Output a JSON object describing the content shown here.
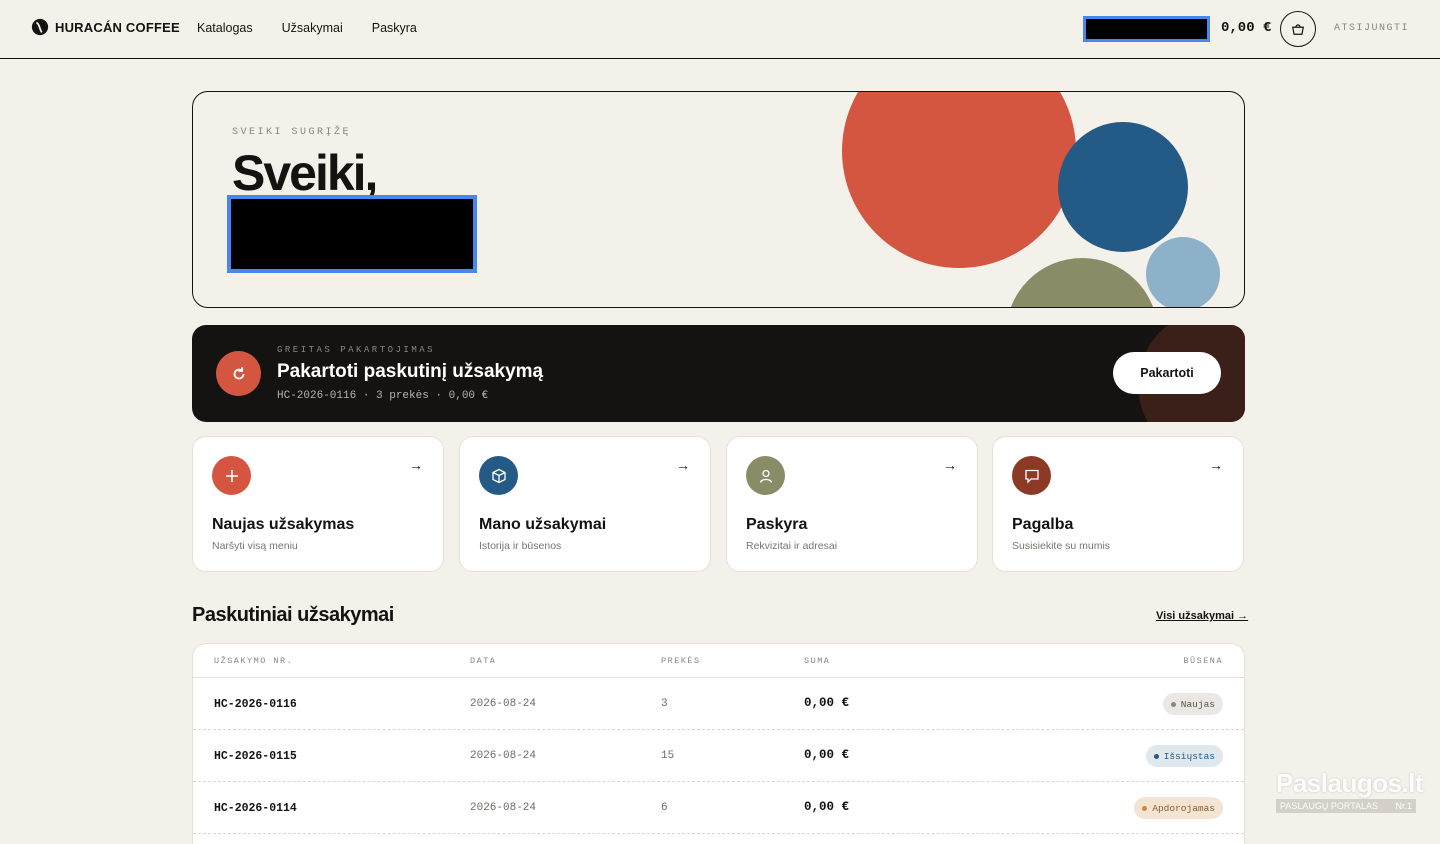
{
  "header": {
    "brand": "HURACÁN COFFEE",
    "nav": [
      "Katalogas",
      "Užsakymai",
      "Paskyra"
    ],
    "cart_total": "0,00 €",
    "logout": "ATSIJUNGTI"
  },
  "hero": {
    "eyebrow": "SVEIKI SUGRĮŽĘ",
    "title": "Sveiki,"
  },
  "reorder": {
    "eyebrow": "GREITAS PAKARTOJIMAS",
    "title": "Pakartoti paskutinį užsakymą",
    "meta": "HC-2026-0116 · 3 prekės · 0,00 €",
    "button": "Pakartoti"
  },
  "cards": [
    {
      "title": "Naujas užsakymas",
      "sub": "Naršyti visą meniu",
      "icon": "plus-icon",
      "color": "#d55640"
    },
    {
      "title": "Mano užsakymai",
      "sub": "Istorija ir būsenos",
      "icon": "box-icon",
      "color": "#245a86"
    },
    {
      "title": "Paskyra",
      "sub": "Rekvizitai ir adresai",
      "icon": "user-icon",
      "color": "#8a8c67"
    },
    {
      "title": "Pagalba",
      "sub": "Susisiekite su mumis",
      "icon": "chat-icon",
      "color": "#8c3a26"
    }
  ],
  "orders": {
    "title": "Paskutiniai užsakymai",
    "link": "Visi užsakymai →",
    "headers": [
      "UŽSAKYMO NR.",
      "DATA",
      "PREKĖS",
      "SUMA",
      "BŪSENA"
    ],
    "rows": [
      {
        "id": "HC-2026-0116",
        "date": "2026-08-24",
        "items": "3",
        "sum": "0,00 €",
        "status": "Naujas"
      },
      {
        "id": "HC-2026-0115",
        "date": "2026-08-24",
        "items": "15",
        "sum": "0,00 €",
        "status": "Išsiųstas"
      },
      {
        "id": "HC-2026-0114",
        "date": "2026-08-24",
        "items": "6",
        "sum": "0,00 €",
        "status": "Apdorojamas"
      }
    ]
  },
  "status_colors": {
    "Naujas": {
      "bg": "#ebe8e3",
      "fg": "#57524b",
      "dot": "#8a857e"
    },
    "Išsiųstas": {
      "bg": "#dfe8ef",
      "fg": "#245a86",
      "dot": "#245a86"
    },
    "Apdorojamas": {
      "bg": "#f3e4d4",
      "fg": "#8c5a26",
      "dot": "#c98a3d"
    }
  },
  "watermark": {
    "title": "Paslaugos.lt",
    "sub": "PASLAUGŲ PORTALAS",
    "badge": "Nr.1"
  }
}
